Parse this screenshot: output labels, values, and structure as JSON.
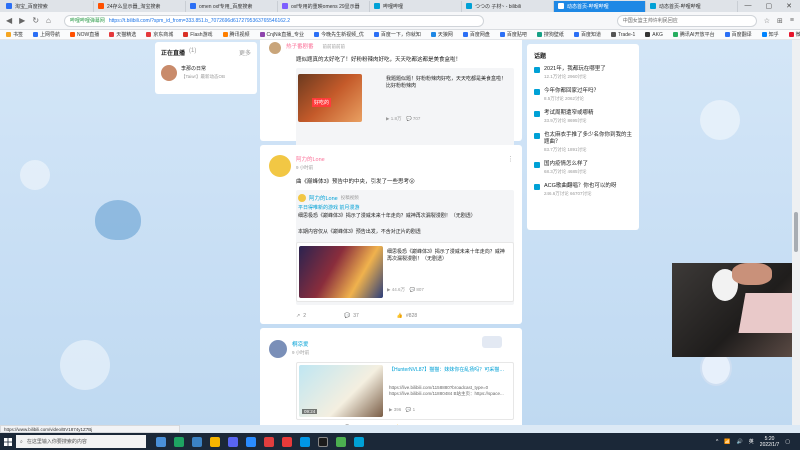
{
  "browser": {
    "tabs": [
      {
        "label": "淘宝_百度搜索",
        "color": "#2b6ff5",
        "active": false
      },
      {
        "label": "24存么显示器_淘宝搜索",
        "color": "#ff5000",
        "active": false
      },
      {
        "label": "omen oxf专用_百度搜索",
        "color": "#2b6ff5",
        "active": false
      },
      {
        "label": "oxf专用的重映omens 29显示器",
        "color": "#7d5fff",
        "active": false
      },
      {
        "label": "哔哩哔哩",
        "color": "#00a1d6",
        "active": false
      },
      {
        "label": "つつの 子材~ - bilibili",
        "color": "#00a1d6",
        "active": false
      },
      {
        "label": "动态首页-哔哩哔哩",
        "color": "#fff",
        "active": true
      },
      {
        "label": "动态首页-哔哩哔哩",
        "color": "#00a1d6",
        "active": false
      }
    ],
    "address_site": "哔哩哔哩弹幕网",
    "address_url": "https://t.bilibili.com/?spm_id_from=333.851.b_7072696d6172795363765546162.2",
    "search_box": "中国女篮主帅许利民回应",
    "bookmarks": [
      "书签",
      "上网导航",
      "NOW直播",
      "天猫精选",
      "京东商城",
      "Flash游戏",
      "腾讯视频",
      "CnjNik直播_专业",
      "今晚先生新视频_优",
      "百度一下，你就知",
      "天狼网",
      "百度网盘",
      "百度贴吧",
      "搜狗壁纸",
      "百度知道",
      "Trade-1",
      "AKG",
      "腾讯AI开放平台",
      "百度翻译",
      "知乎",
      "微博",
      "新浪",
      "小人"
    ],
    "status_url": "https://www.bilibili.com/video/BV1874y1Z7Bj"
  },
  "live": {
    "title": "正在直播",
    "count": "(1)",
    "more": "更多",
    "streamer": "李那の日常",
    "subtitle": "【Taiwr】最新动态OB"
  },
  "posts": [
    {
      "user": "热子番剧番",
      "time": "前前前前前",
      "text": "题似题真的太好吃了！好粉粉辣肉好吃，天天吃都这都是美食盒啦！",
      "video_title": "我题题似题！好粉粉辣肉好吃，天天吃都是美食盒啦！比好粉粉辣肉",
      "video_tag": "好吃的",
      "stats": [
        "1.8万",
        "707"
      ],
      "actions": {
        "share": "1",
        "comment": "4",
        "like": "117"
      }
    },
    {
      "user": "阿力的Lone",
      "time": "9 小时前",
      "text": "曲《巅峰体3》预告中的中央，引发了一些思考😮",
      "repost_user": "阿力的Lone",
      "repost_time": "投稿视频",
      "repost_line1": "平日得唯新的游戏 前月漫游",
      "repost_line2": "细思极恐《巅峰体3》揭示了漫威未来十年走向？威神再次漏裂漫剧！（无剧透）",
      "repost_line3": "本期内容仅从《巅峰体3》预告出发，不含对正片的剧透",
      "video_title": "细思极恐《巅峰体3》揭示了漫威未来十年走向？威神再次漏裂漫剧！（无剧透）",
      "stats": [
        "44.6万",
        "807"
      ],
      "actions": {
        "share": "2",
        "comment": "37",
        "like": "#828"
      }
    },
    {
      "user": "桐凉爱",
      "time": "9 小时前",
      "video_title": "【HunterNVL87】猫猫：妹妹你在乱扬吗？可采猫…",
      "video_desc": "https://live.bilibili.com/1158880?broadcast_type=0 https://live.bilibili.com/11880484 B站主页：https://space...",
      "duration": "09:24",
      "stats": [
        "396",
        "1"
      ],
      "actions": {
        "share": "1",
        "comment": "5",
        "like": "21"
      }
    }
  ],
  "topics": {
    "title": "话题",
    "items": [
      {
        "t": "2021年，我都玩在哪里了",
        "m": "12.1万讨论 2960讨论"
      },
      {
        "t": "今年你都回家过年吗？",
        "m": "8.5万讨论 2062讨论"
      },
      {
        "t": "考试周期遭窄或哪精",
        "m": "33.9万讨论 8695讨论"
      },
      {
        "t": "也太麻衣手推了多少名你你到我的主题曲？",
        "m": "83.7万讨论 1891讨论"
      },
      {
        "t": "国内疫情怎么样了",
        "m": "68.3万讨论 4685讨论"
      },
      {
        "t": "ACG歌曲翻唱？你也可以的呀",
        "m": "246.6万讨论 66707讨论"
      }
    ]
  },
  "taskbar": {
    "search": "在这里输入你要搜索的内容",
    "time": "5:20",
    "date": "2022/1/7",
    "lang": "英"
  }
}
